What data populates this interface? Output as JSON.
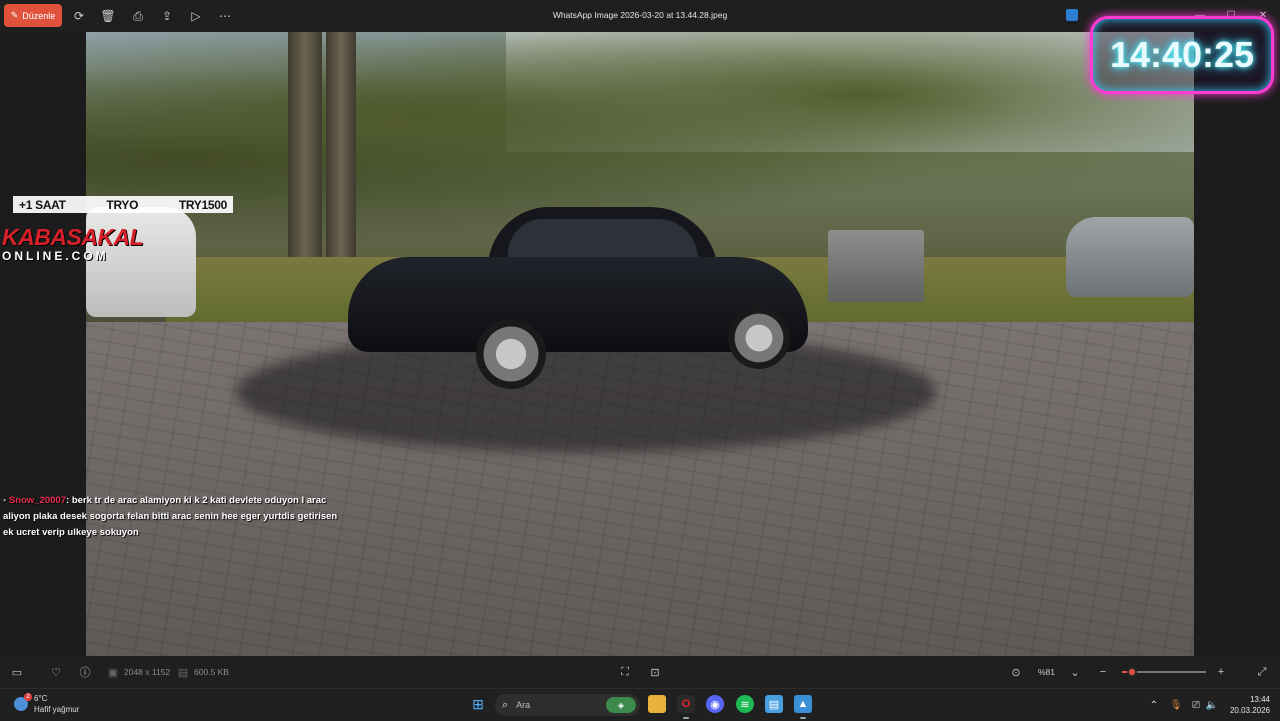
{
  "toolbar": {
    "edit_label": "Düzenle",
    "window_title": "WhatsApp Image 2026-03-20 at 13.44.28.jpeg"
  },
  "photo": {
    "overlay_info": [
      "+1 SAAT",
      "TRYO",
      "TRY1500"
    ],
    "logo_top": "KABASAKAL",
    "logo_bottom": "ONLINE.COM",
    "clock": "14:40:25",
    "chat": {
      "username": "Snow_20007",
      "message": ": berk tr de arac alamiyon ki k 2 kati devlete oduyon l arac aliyon plaka desek sogorta felan bitti arac senin hee eger yurtdis getirisen ek ucret verip ulkeye sokuyon"
    }
  },
  "bottombar": {
    "dimensions": "2048 x 1152",
    "filesize": "600.5 KB",
    "zoom_label": "%81",
    "zoom_level_fraction": 0.12
  },
  "taskbar": {
    "weather_temp": "6°C",
    "weather_desc": "Hafif yağmur",
    "weather_badge": "2",
    "search_label": "Ara",
    "time": "13:44",
    "date": "20.03.2026"
  },
  "icons": {
    "rotate": "rotate-icon",
    "delete": "trash-icon",
    "print": "print-icon",
    "share": "share-icon",
    "slideshow": "slideshow-icon",
    "more": "more-icon"
  },
  "colors": {
    "accent": "#e0523c",
    "clock_border": "#ff3bd4",
    "chat_user": "#e62e4d",
    "logo_red": "#d8202a"
  }
}
